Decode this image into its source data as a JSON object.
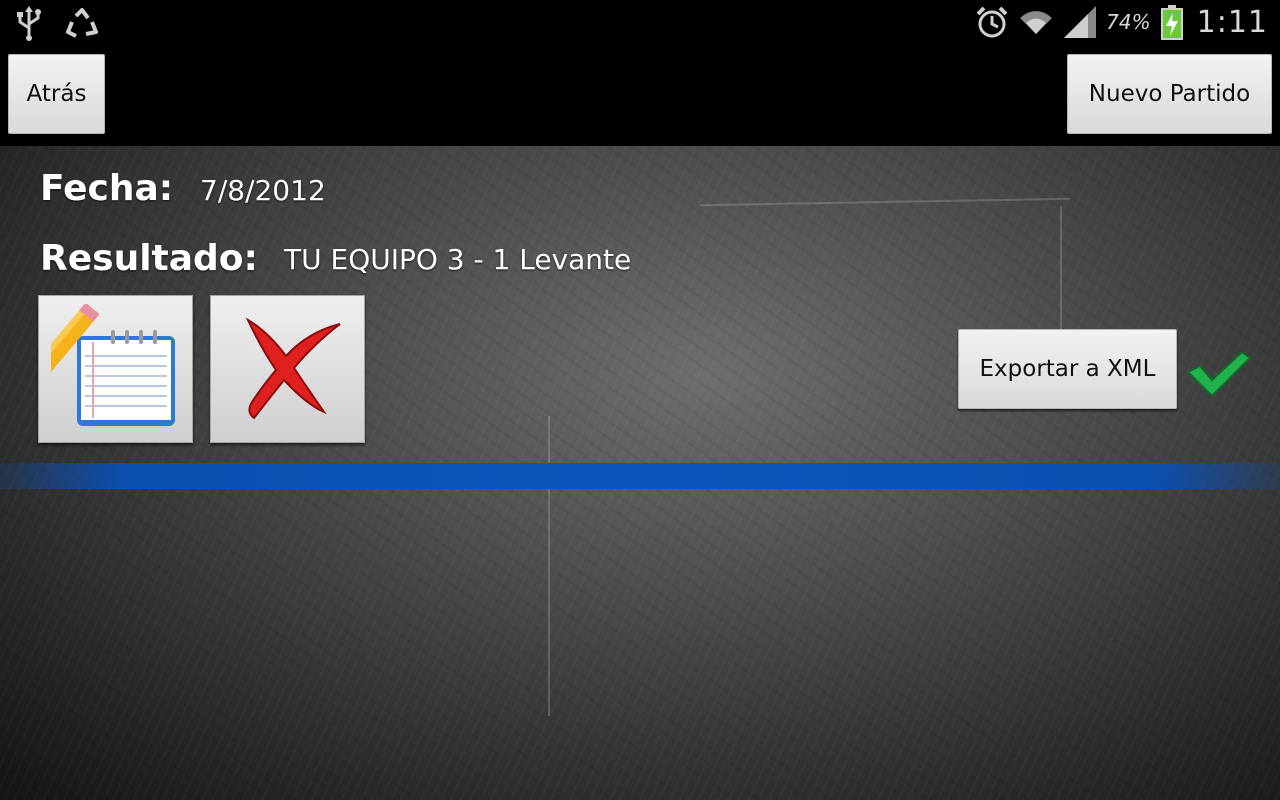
{
  "status_bar": {
    "battery_percent_text": "74%",
    "time": "1:11",
    "left_icons": [
      "usb-icon",
      "recycle-icon"
    ],
    "right_icons": [
      "alarm-icon",
      "wifi-icon",
      "signal-icon",
      "battery-charging-icon"
    ]
  },
  "action_bar": {
    "back_label": "Atrás",
    "new_match_label": "Nuevo Partido"
  },
  "match": {
    "fecha_label": "Fecha:",
    "fecha_value": "7/8/2012",
    "resultado_label": "Resultado:",
    "resultado_value": "TU EQUIPO 3 - 1 Levante"
  },
  "actions": {
    "edit_icon": "edit-notepad-icon",
    "delete_icon": "delete-x-icon",
    "export_label": "Exportar a XML",
    "export_status_icon": "check-icon"
  },
  "colors": {
    "divider": "#0b55b8",
    "check": "#22b14c",
    "delete": "#e0201e"
  }
}
